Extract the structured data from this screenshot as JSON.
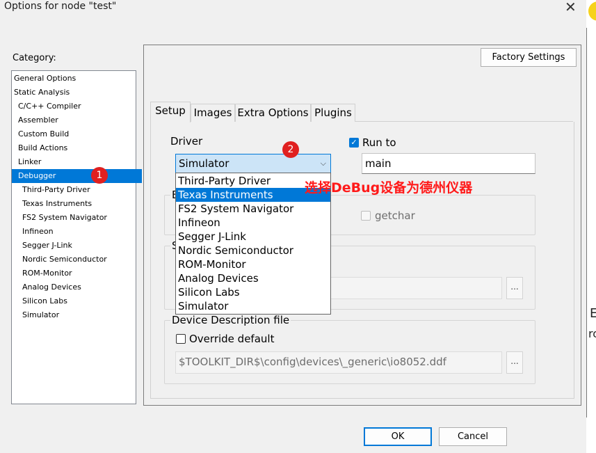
{
  "window": {
    "title": "Options for node \"test\"",
    "close_symbol": "✕"
  },
  "category": {
    "label": "Category:",
    "items": [
      {
        "label": "General Options"
      },
      {
        "label": "Static Analysis"
      },
      {
        "label": "C/C++ Compiler"
      },
      {
        "label": "Assembler"
      },
      {
        "label": "Custom Build"
      },
      {
        "label": "Build Actions"
      },
      {
        "label": "Linker"
      },
      {
        "label": "Debugger"
      },
      {
        "label": "Third-Party Driver"
      },
      {
        "label": "Texas Instruments"
      },
      {
        "label": "FS2 System Navigator"
      },
      {
        "label": "Infineon"
      },
      {
        "label": "Segger J-Link"
      },
      {
        "label": "Nordic Semiconductor"
      },
      {
        "label": "ROM-Monitor"
      },
      {
        "label": "Analog Devices"
      },
      {
        "label": "Silicon Labs"
      },
      {
        "label": "Simulator"
      }
    ],
    "selected": "Debugger"
  },
  "factory_settings": "Factory Settings",
  "tabs": [
    {
      "label": "Setup"
    },
    {
      "label": "Images"
    },
    {
      "label": "Extra Options"
    },
    {
      "label": "Plugins"
    }
  ],
  "driver": {
    "label": "Driver",
    "value": "Simulator",
    "options": [
      "Third-Party Driver",
      "Texas Instruments",
      "FS2 System Navigator",
      "Infineon",
      "Segger J-Link",
      "Nordic Semiconductor",
      "ROM-Monitor",
      "Analog Devices",
      "Silicon Labs",
      "Simulator"
    ],
    "highlighted": "Texas Instruments"
  },
  "run_to": {
    "label": "Run to",
    "checked": true,
    "value": "main"
  },
  "emulation_group": {
    "label_partial": "E",
    "getchar_label": "getchar"
  },
  "setup_group": {
    "label_partial": "S"
  },
  "device_description": {
    "label": "Device Description file",
    "override_label": "Override default",
    "path": "$TOOLKIT_DIR$\\config\\devices\\_generic\\io8052.ddf",
    "browse": "..."
  },
  "browse_label": "...",
  "annotations": {
    "badge1": "1",
    "badge2": "2",
    "note": "选择DeBug设备为德州仪器"
  },
  "buttons": {
    "ok": "OK",
    "cancel": "Cancel"
  },
  "background_fragments": {
    "text1": "E",
    "text2": "ro"
  },
  "colors": {
    "accent": "#0078d7",
    "annotation": "#ff1a1a",
    "selection": "#0078d7"
  }
}
